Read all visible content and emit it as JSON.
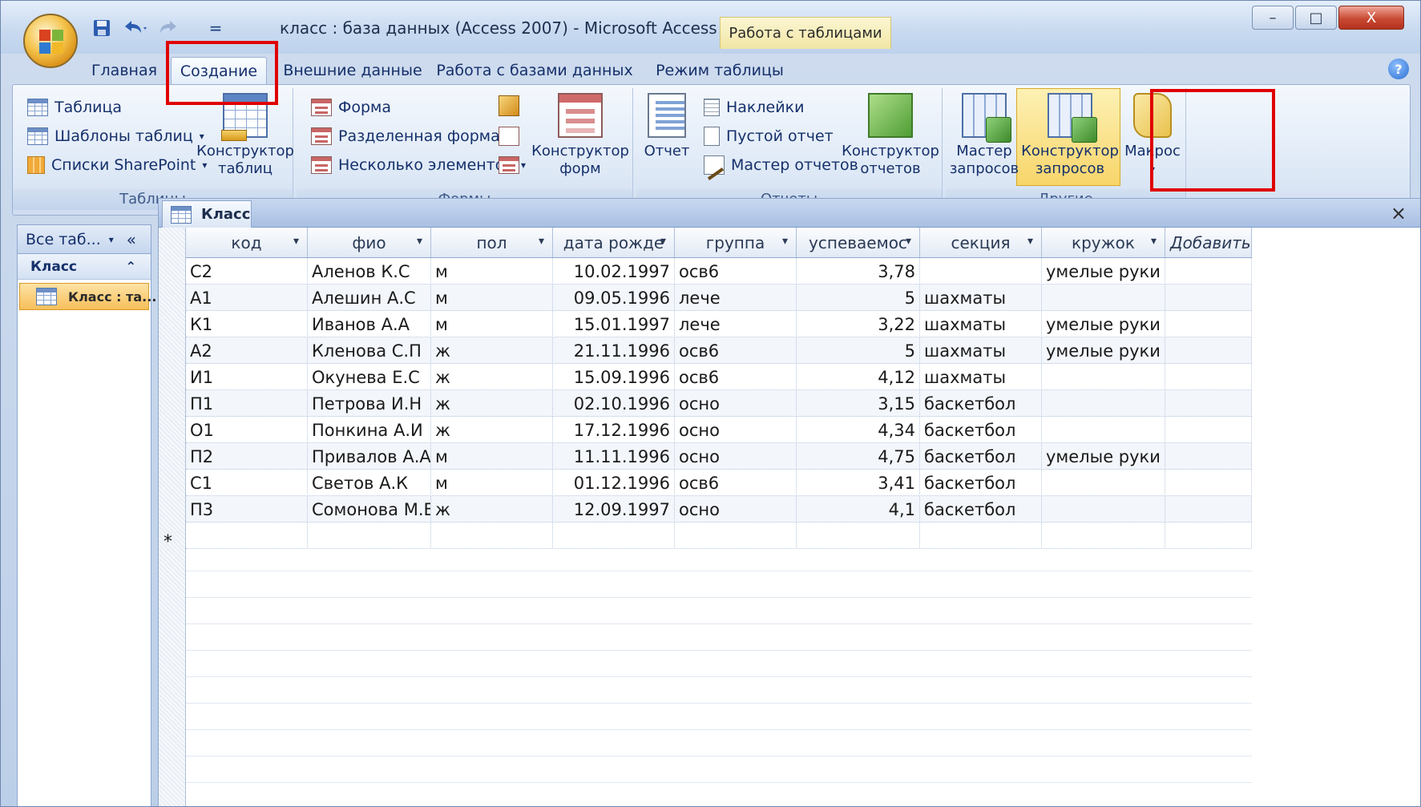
{
  "window": {
    "title": "класс : база данных (Access 2007) - Microsoft Access",
    "context_tab": "Работа с таблицами",
    "controls": {
      "minimize": "–",
      "maximize": "□",
      "close": "X"
    }
  },
  "qat": {
    "save_icon": "save-icon",
    "undo_icon": "undo-icon",
    "redo_icon": "redo-icon",
    "customize": "="
  },
  "tabs": [
    {
      "label": "Главная"
    },
    {
      "label": "Создание"
    },
    {
      "label": "Внешние данные"
    },
    {
      "label": "Работа с базами данных"
    },
    {
      "label": "Режим таблицы"
    }
  ],
  "ribbon": {
    "tables": {
      "label": "Таблицы",
      "table": "Таблица",
      "templates": "Шаблоны таблиц",
      "sharepoint": "Списки SharePoint",
      "designer_line1": "Конструктор",
      "designer_line2": "таблиц"
    },
    "forms": {
      "label": "Формы",
      "form": "Форма",
      "split_form": "Разделенная форма",
      "multiple": "Несколько элементов",
      "designer_line1": "Конструктор",
      "designer_line2": "форм"
    },
    "reports": {
      "label": "Отчеты",
      "report": "Отчет",
      "labels": "Наклейки",
      "blank_report": "Пустой отчет",
      "report_wizard": "Мастер отчетов",
      "designer_line1": "Конструктор",
      "designer_line2": "отчетов"
    },
    "other": {
      "label": "Другие",
      "query_wizard_line1": "Мастер",
      "query_wizard_line2": "запросов",
      "query_designer_line1": "Конструктор",
      "query_designer_line2": "запросов",
      "macro": "Макрос"
    }
  },
  "nav": {
    "header": "Все таб...",
    "group": "Класс",
    "item": "Класс : та..."
  },
  "document": {
    "tab": "Класс",
    "close": "×"
  },
  "table": {
    "columns": [
      "код",
      "фио",
      "пол",
      "дата рожде",
      "группа",
      "успеваемос",
      "секция",
      "кружок",
      "Добавить поле"
    ],
    "rows": [
      [
        "С2",
        "Аленов К.С",
        "м",
        "10.02.1997",
        "осв6",
        "3,78",
        "",
        "умелые руки"
      ],
      [
        "А1",
        "Алешин А.С",
        "м",
        "09.05.1996",
        "лече",
        "5",
        "шахматы",
        ""
      ],
      [
        "К1",
        "Иванов А.А",
        "м",
        "15.01.1997",
        "лече",
        "3,22",
        "шахматы",
        "умелые руки"
      ],
      [
        "А2",
        "Кленова С.П",
        "ж",
        "21.11.1996",
        "осв6",
        "5",
        "шахматы",
        "умелые руки"
      ],
      [
        "И1",
        "Окунева Е.С",
        "ж",
        "15.09.1996",
        "осв6",
        "4,12",
        "шахматы",
        ""
      ],
      [
        "П1",
        "Петрова И.Н",
        "ж",
        "02.10.1996",
        "осно",
        "3,15",
        "баскетбол",
        ""
      ],
      [
        "О1",
        "Понкина А.И",
        "ж",
        "17.12.1996",
        "осно",
        "4,34",
        "баскетбол",
        ""
      ],
      [
        "П2",
        "Привалов А.А",
        "м",
        "11.11.1996",
        "осно",
        "4,75",
        "баскетбол",
        "умелые руки"
      ],
      [
        "С1",
        "Светов А.К",
        "м",
        "01.12.1996",
        "осв6",
        "3,41",
        "баскетбол",
        ""
      ],
      [
        "П3",
        "Сомонова М.Е",
        "ж",
        "12.09.1997",
        "осно",
        "4,1",
        "баскетбол",
        ""
      ]
    ],
    "new_row_marker": "*"
  },
  "colors": {
    "highlight": "#e00000",
    "accent": "#f8d56a"
  }
}
